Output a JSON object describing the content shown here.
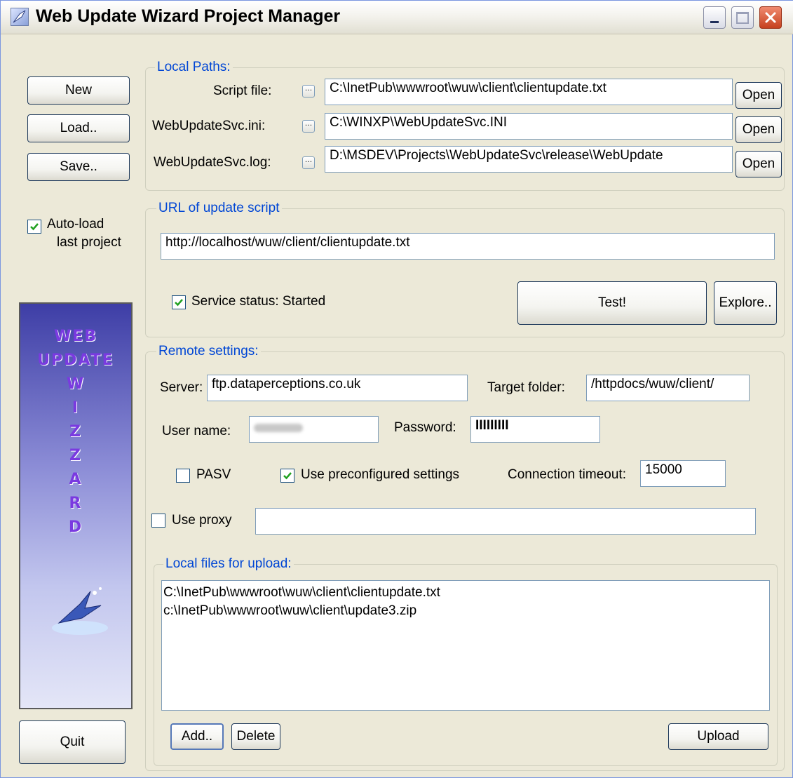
{
  "window": {
    "title": "Web Update Wizard Project Manager"
  },
  "left_panel": {
    "new_label": "New",
    "load_label": "Load..",
    "save_label": "Save..",
    "autoload_label_line1": "Auto-load",
    "autoload_label_line2": "last project",
    "autoload_checked": true,
    "banner_lines": [
      "Web",
      "Update",
      "W",
      "i",
      "z",
      "z",
      "a",
      "r",
      "d"
    ],
    "quit_label": "Quit"
  },
  "local_paths": {
    "legend": "Local Paths:",
    "script_label": "Script file:",
    "script_value": "C:\\InetPub\\wwwroot\\wuw\\client\\clientupdate.txt",
    "ini_label": "WebUpdateSvc.ini:",
    "ini_value": "C:\\WINXP\\WebUpdateSvc.INI",
    "log_label": "WebUpdateSvc.log:",
    "log_value": "D:\\MSDEV\\Projects\\WebUpdateSvc\\release\\WebUpdate",
    "open_label": "Open"
  },
  "url_section": {
    "legend": "URL of update script",
    "url_value": "http://localhost/wuw/client/clientupdate.txt",
    "service_status_label": "Service status: Started",
    "service_checked": true,
    "test_label": "Test!",
    "explore_label": "Explore.."
  },
  "remote": {
    "legend": "Remote settings:",
    "server_label": "Server:",
    "server_value": "ftp.dataperceptions.co.uk",
    "target_label": "Target folder:",
    "target_value": "/httpdocs/wuw/client/",
    "user_label": "User name:",
    "password_label": "Password:",
    "password_value": "IIIIIIIII",
    "pasv_label": "PASV",
    "pasv_checked": false,
    "preconf_label": "Use preconfigured settings",
    "preconf_checked": true,
    "timeout_label": "Connection timeout:",
    "timeout_value": "15000",
    "proxy_label": "Use proxy",
    "proxy_checked": false,
    "proxy_value": ""
  },
  "upload": {
    "legend": "Local files for upload:",
    "files": [
      "C:\\InetPub\\wwwroot\\wuw\\client\\clientupdate.txt",
      "c:\\InetPub\\wwwroot\\wuw\\client\\update3.zip"
    ],
    "add_label": "Add..",
    "delete_label": "Delete",
    "upload_label": "Upload"
  }
}
